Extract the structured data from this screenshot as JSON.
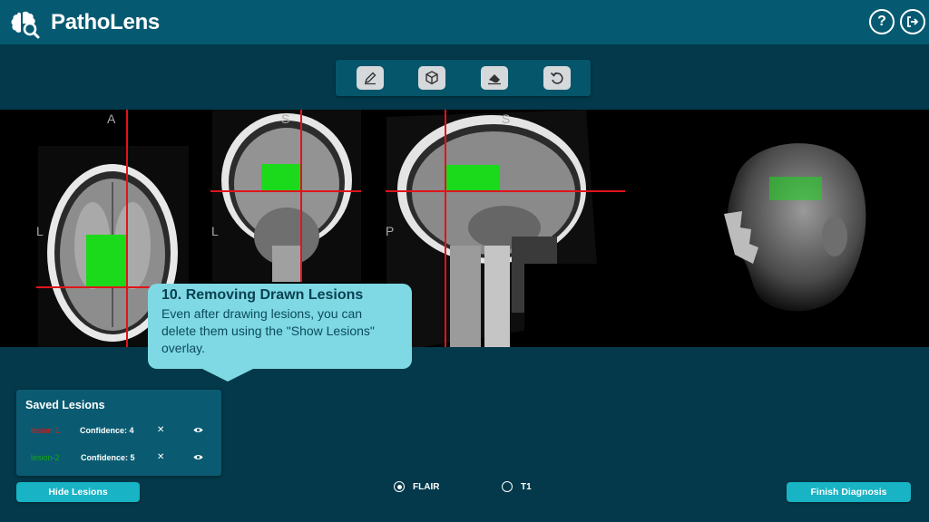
{
  "header": {
    "app_title": "PathoLens",
    "help_icon_glyph": "?",
    "logo_icon": "brain-search-icon",
    "help_icon": "help-icon",
    "logout_icon": "logout-icon"
  },
  "toolbar": {
    "tools": [
      {
        "name": "pencil-icon"
      },
      {
        "name": "cube-icon"
      },
      {
        "name": "eraser-icon"
      },
      {
        "name": "undo-icon"
      }
    ]
  },
  "viewer": {
    "axial": {
      "top_label": "A",
      "left_label": "L"
    },
    "coronal": {
      "top_label": "S",
      "left_label": "L"
    },
    "sagittal": {
      "top_label": "S",
      "left_label": "P"
    },
    "colors": {
      "lesion": "#1bd91b",
      "crosshair": "#e0141b"
    }
  },
  "tooltip": {
    "title": "10. Removing Drawn Lesions",
    "body": "Even after drawing lesions, you can delete them using the \"Show Lesions\" overlay."
  },
  "saved_lesions": {
    "title": "Saved Lesions",
    "items": [
      {
        "name": "lesion-1",
        "confidence": "Confidence: 4",
        "color": "#e01818",
        "remove": "✕"
      },
      {
        "name": "lesion-2",
        "confidence": "Confidence: 5",
        "color": "#16a516",
        "remove": "✕"
      }
    ]
  },
  "buttons": {
    "hide_lesions": "Hide Lesions",
    "finish_diagnosis": "Finish Diagnosis"
  },
  "sequence": {
    "options": [
      {
        "label": "FLAIR",
        "selected": true
      },
      {
        "label": "T1",
        "selected": false
      }
    ]
  }
}
